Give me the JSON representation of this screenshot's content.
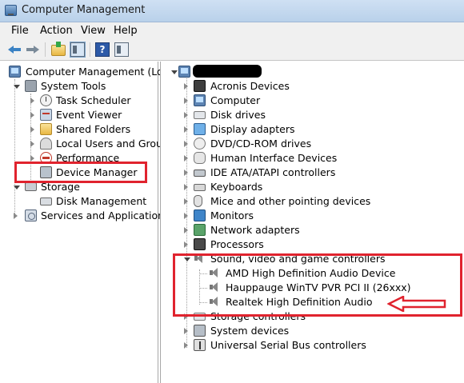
{
  "window": {
    "title": "Computer Management"
  },
  "menubar": {
    "items": [
      "File",
      "Action",
      "View",
      "Help"
    ]
  },
  "toolbar": {
    "buttons": [
      "back-icon",
      "forward-icon",
      "up-icon",
      "show-hide-console-tree-icon",
      "help-icon",
      "action-pane-icon"
    ]
  },
  "left_tree": {
    "root": "Computer Management (Local",
    "system_tools": "System Tools",
    "task_scheduler": "Task Scheduler",
    "event_viewer": "Event Viewer",
    "shared_folders": "Shared Folders",
    "local_users": "Local Users and Groups",
    "performance": "Performance",
    "device_manager": "Device Manager",
    "storage": "Storage",
    "disk_management": "Disk Management",
    "services": "Services and Applications"
  },
  "right_tree": {
    "computer_name": "",
    "categories": [
      "Acronis Devices",
      "Computer",
      "Disk drives",
      "Display adapters",
      "DVD/CD-ROM drives",
      "Human Interface Devices",
      "IDE ATA/ATAPI controllers",
      "Keyboards",
      "Mice and other pointing devices",
      "Monitors",
      "Network adapters",
      "Processors",
      "Sound, video and game controllers",
      "Storage controllers",
      "System devices",
      "Universal Serial Bus controllers"
    ],
    "sound_devices": [
      "AMD High Definition Audio Device",
      "Hauppauge WinTV PVR PCI II (26xxx)",
      "Realtek High Definition Audio"
    ]
  },
  "annotations": {
    "highlight_color": "#e0232e"
  }
}
